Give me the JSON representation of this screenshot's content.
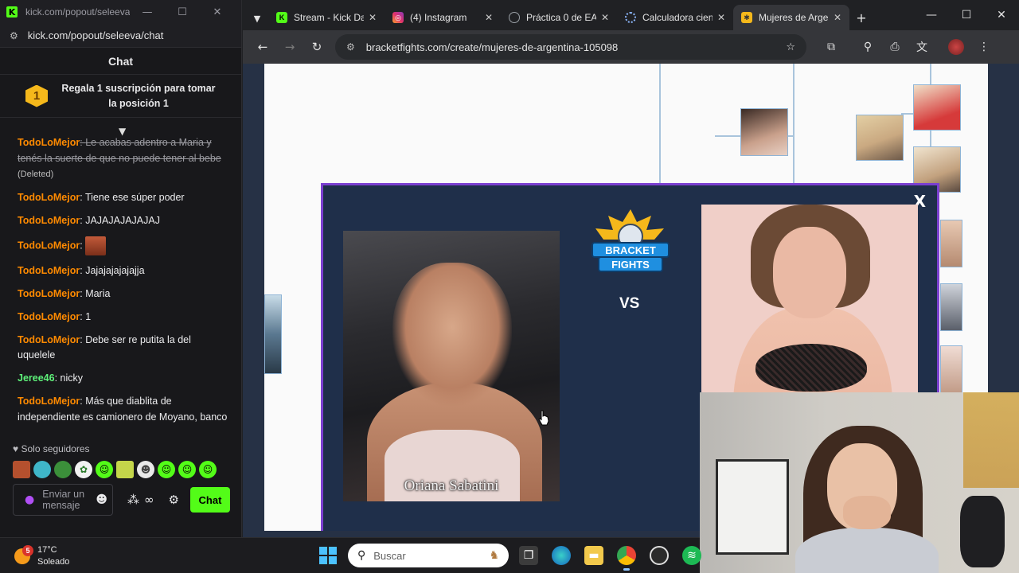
{
  "chat_window": {
    "title_url": "kick.com/popout/seleeva/c...",
    "url": "kick.com/popout/seleeva/chat",
    "header": "Chat",
    "gift_badge": "1",
    "gift_text": "Regala 1 suscripción para tomar la posición 1",
    "messages": [
      {
        "user": "TodoLoMejor",
        "text": "Le acabas adentro a Maria y tenés la suerte de que no puede tener al bebe",
        "deleted": true,
        "deleted_label": "(Deleted)"
      },
      {
        "user": "TodoLoMejor",
        "text": "Tiene ese súper poder"
      },
      {
        "user": "TodoLoMejor",
        "text": "JAJAJAJAJAJAJ"
      },
      {
        "user": "TodoLoMejor",
        "text": "",
        "emote": "emote-image"
      },
      {
        "user": "TodoLoMejor",
        "text": "Jajajajajajajja"
      },
      {
        "user": "TodoLoMejor",
        "text": "Maria"
      },
      {
        "user": "TodoLoMejor",
        "text": "1"
      },
      {
        "user": "TodoLoMejor",
        "text": "Debe ser re putita la del uquelele"
      },
      {
        "user": "Jeree46",
        "text": "nicky",
        "color": "green"
      },
      {
        "user": "TodoLoMejor",
        "text": "Más que diablita de independiente es camionero de Moyano, banco"
      }
    ],
    "followers_label": "Solo seguidores",
    "input_placeholder": "Enviar un mensaje",
    "send_label": "Chat"
  },
  "browser": {
    "tabs": [
      {
        "label": "Stream - Kick Da",
        "icon": "kick-icon",
        "color": "#53fc18"
      },
      {
        "label": "(4) Instagram",
        "icon": "instagram-icon",
        "color": "#e1306c"
      },
      {
        "label": "Práctica 0 de EA",
        "icon": "globe-icon",
        "color": "#9aa0a6"
      },
      {
        "label": "Calculadora cien",
        "icon": "loading-icon",
        "color": "#8ab4f8"
      },
      {
        "label": "Mujeres de Arge",
        "icon": "bracketfights-icon",
        "color": "#f5b81b",
        "active": true
      }
    ],
    "url": "bracketfights.com/create/mujeres-de-argentina-105098"
  },
  "matchup": {
    "close_label": "X",
    "logo_line1": "BRACKET",
    "logo_line2": "FIGHTS",
    "vs_label": "VS",
    "left_name": "Oriana Sabatini"
  },
  "taskbar": {
    "weather_temp": "17°C",
    "weather_desc": "Soleado",
    "weather_badge": "5",
    "search_placeholder": "Buscar"
  },
  "colors": {
    "kick_green": "#53fc18",
    "username_orange": "#ff8a00",
    "modal_border": "#7b3fd0",
    "modal_bg": "#1f2f4a"
  }
}
